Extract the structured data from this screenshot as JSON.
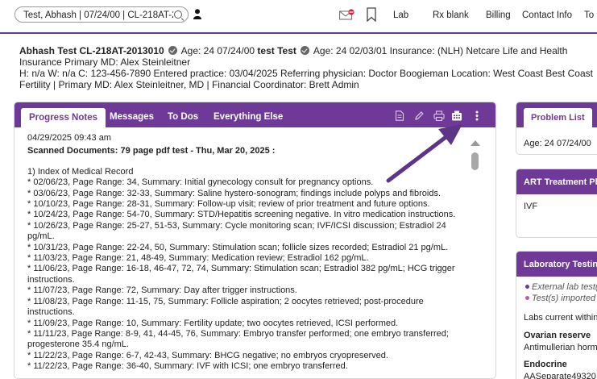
{
  "topbar": {
    "search_value": "Test, Abhash | 07/24/00 | CL-218AT-2",
    "nav": [
      "Lab",
      "Rx blank",
      "Billing",
      "Contact Info",
      "To"
    ]
  },
  "patient": {
    "name_id": "Abhash Test CL-218AT-2013010",
    "age1": "Age: 24 07/24/00",
    "partner": "test Test",
    "age2_insurance": "Age: 24 02/03/01 Insurance: (NLH) Netcare Life and Health Insurance Primary MD: Alex Steinleitner",
    "line3": "H: n/a W: n/a C: 123-456-7890 Entered practice: 03/04/2025 Referring physician: Doctor Boogieman Location: West Coast Best Coast Fertility | Primary MD: Alex Steinleitner, MD | Financial Coordinator: Brett Admin"
  },
  "main": {
    "tabs": [
      "Progress Notes",
      "Messages",
      "To Dos",
      "Everything Else"
    ],
    "note_date": "04/29/2025 09:43 am",
    "note_subject": "Scanned Documents: 79 page pdf test - Thu, Mar 20, 2025 :",
    "lines": [
      "1) Index of Medical Record",
      "* 02/06/23, Page Range: 34, Summary: Initial gynecology consult for pregnancy options.",
      "* 03/06/23, Page Range: 32-33, Summary: Saline hystero-sonogram; findings include polyps and fibroids.",
      "* 10/10/23, Page Range: 28-31, Summary: Follow-up visit; review of prior treatment and future options.",
      "* 10/24/23, Page Range: 54-70, Summary: STD/Hepatitis screening negative. In vitro medication instructions.",
      "* 10/26/23, Page Range: 25-27, 51-53, Summary: Cycle monitoring scan; IVF/ICSI discussion; Estradiol 24 pg/mL.",
      "* 10/31/23, Page Range: 22-24, 50, Summary: Stimulation scan; follicle sizes recorded; Estradiol 21 pg/mL.",
      "* 11/03/23, Page Range: 21, 48-49, Summary: Medication review; Estradiol 162 pg/mL.",
      "* 11/06/23, Page Range: 16-18, 46-47, 72, 74, Summary: Stimulation scan; Estradiol 382 pg/mL; HCG trigger instructions.",
      "* 11/07/23, Page Range: 72, Summary: Day after trigger instructions.",
      "* 11/08/23, Page Range: 11-15, 75, Summary: Follicle aspiration; 2 oocytes retrieved; post-procedure instructions.",
      "* 11/09/23, Page Range: 10, Summary: Fertility update; two oocytes retrieved, ICSI performed.",
      "* 11/11/23, Page Range: 8-9, 41, 44-45, 76, Summary: Embryo transfer performed; one embryo transferred; progesterone 35.4 ng/mL.",
      "* 11/22/23, Page Range: 6-7, 42-43, Summary: BHCG negative; no embryos cryopreserved.",
      "* 11/22/23, Page Range: 36-40, Summary: IVF with ICSI; one embryo transferred."
    ]
  },
  "right": {
    "problem_list": {
      "tab": "Problem List",
      "line": "Age: 24 07/24/00"
    },
    "art_plan": {
      "title": "ART Treatment Pla",
      "line": "IVF"
    },
    "lab_testing": {
      "title": "Laboratory Testing",
      "ext": "External lab test(",
      "imported": "Test(s) imported",
      "labs_current": "Labs current within",
      "ovarian": "Ovarian reserve",
      "amh": "Antimullerian horm",
      "endocrine": "Endocrine",
      "separate": "AASeparate49320"
    }
  },
  "colors": {
    "brand_purple": "#6f3a97",
    "ext_dot": "#6f3a97",
    "import_dot": "#c05aa8"
  }
}
